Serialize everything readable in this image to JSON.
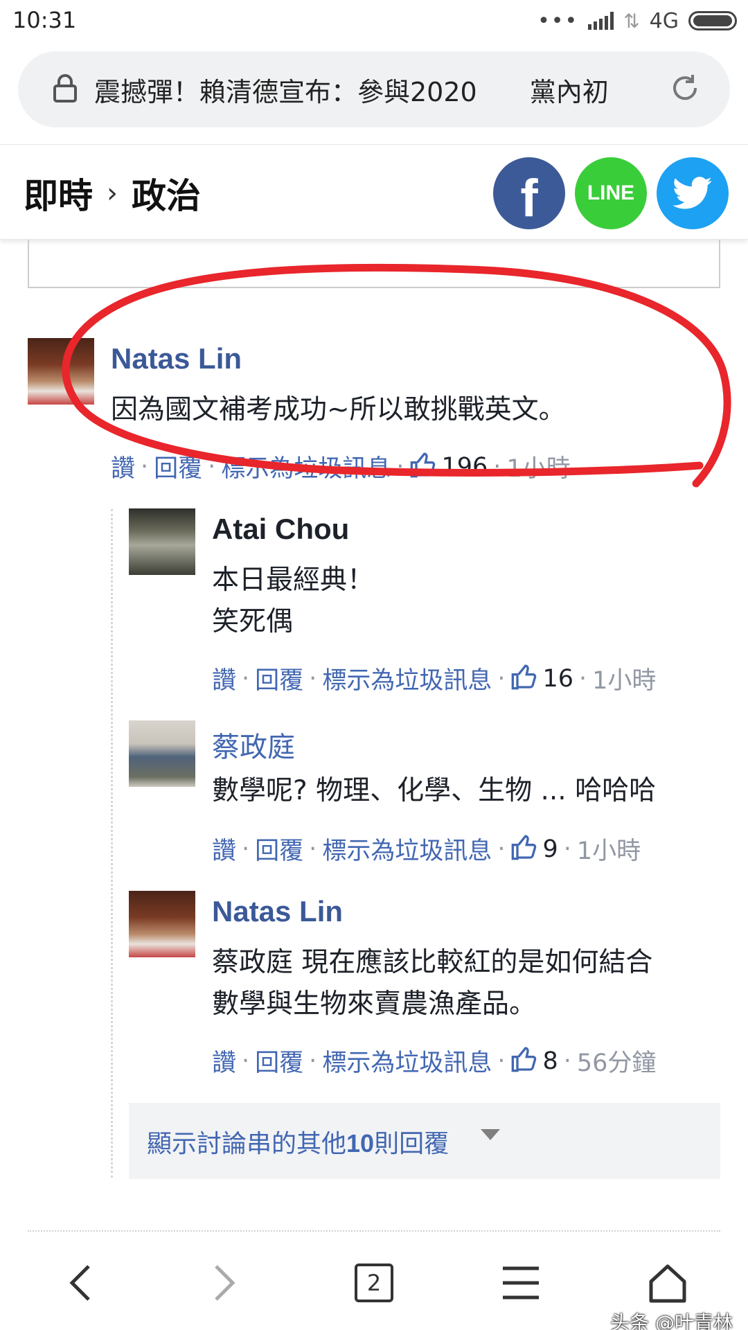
{
  "status_bar": {
    "time": "10:31",
    "network": "4G"
  },
  "url_bar": {
    "title": "震撼彈！賴清德宣布：參與2020　　黨內初"
  },
  "header": {
    "crumb_1": "即時",
    "crumb_sep": "›",
    "crumb_2": "政治",
    "share_fb_label": "f",
    "share_line_label": "LINE"
  },
  "comments": [
    {
      "author": "Natas Lin",
      "lines": [
        "因為國文補考成功~所以敢挑戰英文。"
      ],
      "actions": {
        "like": "讚",
        "reply": "回覆",
        "spam": "標示為垃圾訊息",
        "count": "196",
        "time": "1小時"
      }
    },
    {
      "author": "Atai Chou",
      "lines": [
        "本日最經典！",
        "笑死偶"
      ],
      "actions": {
        "like": "讚",
        "reply": "回覆",
        "spam": "標示為垃圾訊息",
        "count": "16",
        "time": "1小時"
      }
    },
    {
      "author": "蔡政庭",
      "lines": [
        "數學呢? 物理、化學、生物 ... 哈哈哈"
      ],
      "actions": {
        "like": "讚",
        "reply": "回覆",
        "spam": "標示為垃圾訊息",
        "count": "9",
        "time": "1小時"
      }
    },
    {
      "author": "Natas Lin",
      "lines": [
        "蔡政庭 現在應該比較紅的是如何結合",
        "數學與生物來賣農漁產品。"
      ],
      "actions": {
        "like": "讚",
        "reply": "回覆",
        "spam": "標示為垃圾訊息",
        "count": "8",
        "time": "56分鐘"
      }
    }
  ],
  "more_replies": {
    "prefix": "顯示討論串的其他",
    "count": "10",
    "suffix": "則回覆"
  },
  "bottom_nav": {
    "tab_count": "2"
  },
  "watermark": "头条 @叶青林",
  "colors": {
    "link": "#4267b2",
    "annotation": "#e8262b",
    "facebook": "#3d5a98",
    "line": "#3acd3a",
    "twitter": "#1da1f2"
  },
  "icons": [
    "lock-icon",
    "reload-icon",
    "facebook-icon",
    "line-icon",
    "twitter-icon",
    "like-icon",
    "caret-down-icon",
    "back-icon",
    "forward-icon",
    "menu-icon",
    "home-icon"
  ]
}
